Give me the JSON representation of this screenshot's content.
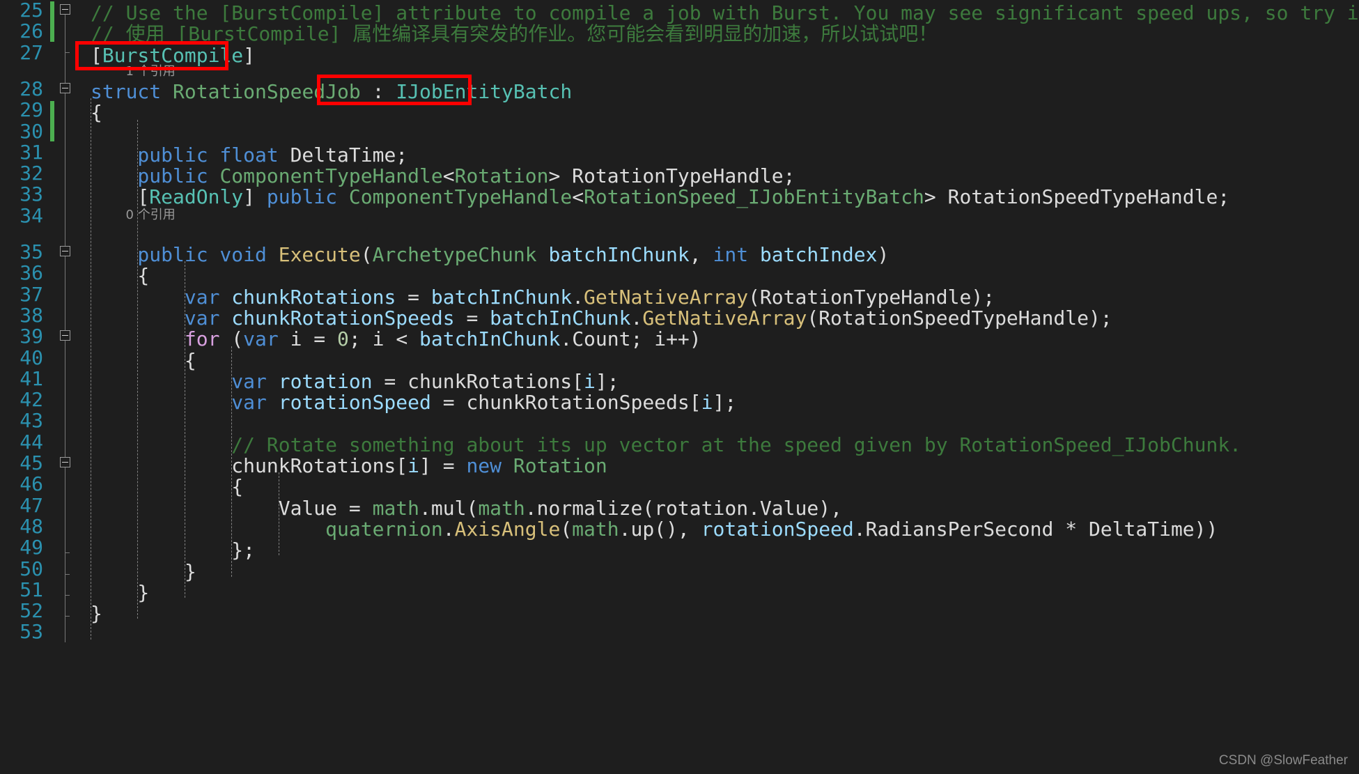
{
  "editor": {
    "theme_background": "#1e1e1e",
    "line_number_color": "#2b91af",
    "change_bar_color": "#4caf50",
    "annotation_color": "#ff0000",
    "watermark": "CSDN @SlowFeather"
  },
  "line_numbers": [
    "25",
    "26",
    "27",
    "28",
    "29",
    "30",
    "31",
    "32",
    "33",
    "34",
    "35",
    "36",
    "37",
    "38",
    "39",
    "40",
    "41",
    "42",
    "43",
    "44",
    "45",
    "46",
    "47",
    "48",
    "49",
    "50",
    "51",
    "52",
    "53"
  ],
  "codelens": [
    {
      "label": "1 个引用",
      "line": "27"
    },
    {
      "label": "0 个引用",
      "line": "34"
    }
  ],
  "annotations": [
    {
      "name": "burstcompile-highlight",
      "label": "[BurstCompile]"
    },
    {
      "name": "ijobentitybatch-highlight",
      "label": "IJobEntityBatch"
    }
  ],
  "code_lines": [
    {
      "number": "25",
      "tokens": [
        {
          "text": "// Use the [BurstCompile] attribute to compile a job with Burst. You may see significant speed ups, so try it!",
          "cls": "t-comment"
        }
      ]
    },
    {
      "number": "26",
      "tokens": [
        {
          "text": "// 使用 [BurstCompile] 属性编译具有突发的作业。您可能会看到明显的加速，所以试试吧！",
          "cls": "t-comment"
        }
      ]
    },
    {
      "number": "27",
      "tokens": [
        {
          "text": "[",
          "cls": "t-punct"
        },
        {
          "text": "BurstCompile",
          "cls": "t-class"
        },
        {
          "text": "]",
          "cls": "t-punct"
        }
      ]
    },
    {
      "number": "28",
      "tokens": [
        {
          "text": "struct ",
          "cls": "t-keyword"
        },
        {
          "text": "RotationSpeedJob",
          "cls": "t-type"
        },
        {
          "text": " : ",
          "cls": "t-punct"
        },
        {
          "text": "IJobEntityBatch",
          "cls": "t-class"
        }
      ]
    },
    {
      "number": "29",
      "tokens": [
        {
          "text": "{",
          "cls": "t-punct"
        }
      ]
    },
    {
      "number": "30",
      "tokens": []
    },
    {
      "number": "31",
      "tokens": [
        {
          "text": "    public float ",
          "cls": "t-keyword"
        },
        {
          "text": "DeltaTime;",
          "cls": "t-plain"
        }
      ]
    },
    {
      "number": "32",
      "tokens": [
        {
          "text": "    public ",
          "cls": "t-keyword"
        },
        {
          "text": "ComponentTypeHandle",
          "cls": "t-type"
        },
        {
          "text": "<",
          "cls": "t-punct"
        },
        {
          "text": "Rotation",
          "cls": "t-type"
        },
        {
          "text": "> ",
          "cls": "t-punct"
        },
        {
          "text": "RotationTypeHandle;",
          "cls": "t-plain"
        }
      ]
    },
    {
      "number": "33",
      "tokens": [
        {
          "text": "    [",
          "cls": "t-punct"
        },
        {
          "text": "ReadOnly",
          "cls": "t-class"
        },
        {
          "text": "] ",
          "cls": "t-punct"
        },
        {
          "text": "public ",
          "cls": "t-keyword"
        },
        {
          "text": "ComponentTypeHandle",
          "cls": "t-type"
        },
        {
          "text": "<",
          "cls": "t-punct"
        },
        {
          "text": "RotationSpeed_IJobEntityBatch",
          "cls": "t-type"
        },
        {
          "text": "> ",
          "cls": "t-punct"
        },
        {
          "text": "RotationSpeedTypeHandle;",
          "cls": "t-plain"
        }
      ]
    },
    {
      "number": "34",
      "tokens": []
    },
    {
      "number": "35",
      "tokens": [
        {
          "text": "    public void ",
          "cls": "t-keyword"
        },
        {
          "text": "Execute",
          "cls": "t-method"
        },
        {
          "text": "(",
          "cls": "t-punct"
        },
        {
          "text": "ArchetypeChunk",
          "cls": "t-type"
        },
        {
          "text": " ",
          "cls": "t-punct"
        },
        {
          "text": "batchInChunk",
          "cls": "t-var"
        },
        {
          "text": ", ",
          "cls": "t-punct"
        },
        {
          "text": "int ",
          "cls": "t-keyword"
        },
        {
          "text": "batchIndex",
          "cls": "t-var"
        },
        {
          "text": ")",
          "cls": "t-punct"
        }
      ]
    },
    {
      "number": "36",
      "tokens": [
        {
          "text": "    {",
          "cls": "t-punct"
        }
      ]
    },
    {
      "number": "37",
      "tokens": [
        {
          "text": "        var ",
          "cls": "t-keyword"
        },
        {
          "text": "chunkRotations",
          "cls": "t-var"
        },
        {
          "text": " = ",
          "cls": "t-punct"
        },
        {
          "text": "batchInChunk",
          "cls": "t-var"
        },
        {
          "text": ".",
          "cls": "t-punct"
        },
        {
          "text": "GetNativeArray",
          "cls": "t-method"
        },
        {
          "text": "(",
          "cls": "t-punct"
        },
        {
          "text": "RotationTypeHandle",
          "cls": "t-plain"
        },
        {
          "text": ");",
          "cls": "t-punct"
        }
      ]
    },
    {
      "number": "38",
      "tokens": [
        {
          "text": "        var ",
          "cls": "t-keyword"
        },
        {
          "text": "chunkRotationSpeeds",
          "cls": "t-var"
        },
        {
          "text": " = ",
          "cls": "t-punct"
        },
        {
          "text": "batchInChunk",
          "cls": "t-var"
        },
        {
          "text": ".",
          "cls": "t-punct"
        },
        {
          "text": "GetNativeArray",
          "cls": "t-method"
        },
        {
          "text": "(",
          "cls": "t-punct"
        },
        {
          "text": "RotationSpeedTypeHandle",
          "cls": "t-plain"
        },
        {
          "text": ");",
          "cls": "t-punct"
        }
      ]
    },
    {
      "number": "39",
      "tokens": [
        {
          "text": "        for ",
          "cls": "t-control"
        },
        {
          "text": "(",
          "cls": "t-punct"
        },
        {
          "text": "var ",
          "cls": "t-keyword"
        },
        {
          "text": "i",
          "cls": "t-plain"
        },
        {
          "text": " = ",
          "cls": "t-punct"
        },
        {
          "text": "0",
          "cls": "t-num"
        },
        {
          "text": "; ",
          "cls": "t-punct"
        },
        {
          "text": "i",
          "cls": "t-plain"
        },
        {
          "text": " < ",
          "cls": "t-punct"
        },
        {
          "text": "batchInChunk",
          "cls": "t-var"
        },
        {
          "text": ".",
          "cls": "t-punct"
        },
        {
          "text": "Count",
          "cls": "t-plain"
        },
        {
          "text": "; ",
          "cls": "t-punct"
        },
        {
          "text": "i",
          "cls": "t-plain"
        },
        {
          "text": "++)",
          "cls": "t-punct"
        }
      ]
    },
    {
      "number": "40",
      "tokens": [
        {
          "text": "        {",
          "cls": "t-punct"
        }
      ]
    },
    {
      "number": "41",
      "tokens": [
        {
          "text": "            var ",
          "cls": "t-keyword"
        },
        {
          "text": "rotation",
          "cls": "t-var"
        },
        {
          "text": " = ",
          "cls": "t-punct"
        },
        {
          "text": "chunkRotations",
          "cls": "t-plain"
        },
        {
          "text": "[",
          "cls": "t-punct"
        },
        {
          "text": "i",
          "cls": "t-var"
        },
        {
          "text": "];",
          "cls": "t-punct"
        }
      ]
    },
    {
      "number": "42",
      "tokens": [
        {
          "text": "            var ",
          "cls": "t-keyword"
        },
        {
          "text": "rotationSpeed",
          "cls": "t-var"
        },
        {
          "text": " = ",
          "cls": "t-punct"
        },
        {
          "text": "chunkRotationSpeeds",
          "cls": "t-plain"
        },
        {
          "text": "[",
          "cls": "t-punct"
        },
        {
          "text": "i",
          "cls": "t-var"
        },
        {
          "text": "];",
          "cls": "t-punct"
        }
      ]
    },
    {
      "number": "43",
      "tokens": []
    },
    {
      "number": "44",
      "tokens": [
        {
          "text": "            // Rotate something about its up vector at the speed given by RotationSpeed_IJobChunk.",
          "cls": "t-comment"
        }
      ]
    },
    {
      "number": "45",
      "tokens": [
        {
          "text": "            chunkRotations",
          "cls": "t-plain"
        },
        {
          "text": "[",
          "cls": "t-punct"
        },
        {
          "text": "i",
          "cls": "t-var"
        },
        {
          "text": "] = ",
          "cls": "t-punct"
        },
        {
          "text": "new ",
          "cls": "t-keyword"
        },
        {
          "text": "Rotation",
          "cls": "t-type"
        }
      ]
    },
    {
      "number": "46",
      "tokens": [
        {
          "text": "            {",
          "cls": "t-punct"
        }
      ]
    },
    {
      "number": "47",
      "tokens": [
        {
          "text": "                Value",
          "cls": "t-plain"
        },
        {
          "text": " = ",
          "cls": "t-punct"
        },
        {
          "text": "math",
          "cls": "t-type"
        },
        {
          "text": ".",
          "cls": "t-punct"
        },
        {
          "text": "mul",
          "cls": "t-plain"
        },
        {
          "text": "(",
          "cls": "t-punct"
        },
        {
          "text": "math",
          "cls": "t-type"
        },
        {
          "text": ".",
          "cls": "t-punct"
        },
        {
          "text": "normalize",
          "cls": "t-plain"
        },
        {
          "text": "(",
          "cls": "t-punct"
        },
        {
          "text": "rotation",
          "cls": "t-plain"
        },
        {
          "text": ".",
          "cls": "t-punct"
        },
        {
          "text": "Value",
          "cls": "t-plain"
        },
        {
          "text": "),",
          "cls": "t-punct"
        }
      ]
    },
    {
      "number": "48",
      "tokens": [
        {
          "text": "                    quaternion",
          "cls": "t-type"
        },
        {
          "text": ".",
          "cls": "t-punct"
        },
        {
          "text": "AxisAngle",
          "cls": "t-method"
        },
        {
          "text": "(",
          "cls": "t-punct"
        },
        {
          "text": "math",
          "cls": "t-type"
        },
        {
          "text": ".",
          "cls": "t-punct"
        },
        {
          "text": "up",
          "cls": "t-plain"
        },
        {
          "text": "(), ",
          "cls": "t-punct"
        },
        {
          "text": "rotationSpeed",
          "cls": "t-var"
        },
        {
          "text": ".",
          "cls": "t-punct"
        },
        {
          "text": "RadiansPerSecond",
          "cls": "t-plain"
        },
        {
          "text": " * ",
          "cls": "t-punct"
        },
        {
          "text": "DeltaTime",
          "cls": "t-plain"
        },
        {
          "text": "))",
          "cls": "t-punct"
        }
      ]
    },
    {
      "number": "49",
      "tokens": [
        {
          "text": "            };",
          "cls": "t-punct"
        }
      ]
    },
    {
      "number": "50",
      "tokens": [
        {
          "text": "        }",
          "cls": "t-punct"
        }
      ]
    },
    {
      "number": "51",
      "tokens": [
        {
          "text": "    }",
          "cls": "t-punct"
        }
      ]
    },
    {
      "number": "52",
      "tokens": [
        {
          "text": "}",
          "cls": "t-punct"
        }
      ]
    },
    {
      "number": "53",
      "tokens": []
    }
  ]
}
